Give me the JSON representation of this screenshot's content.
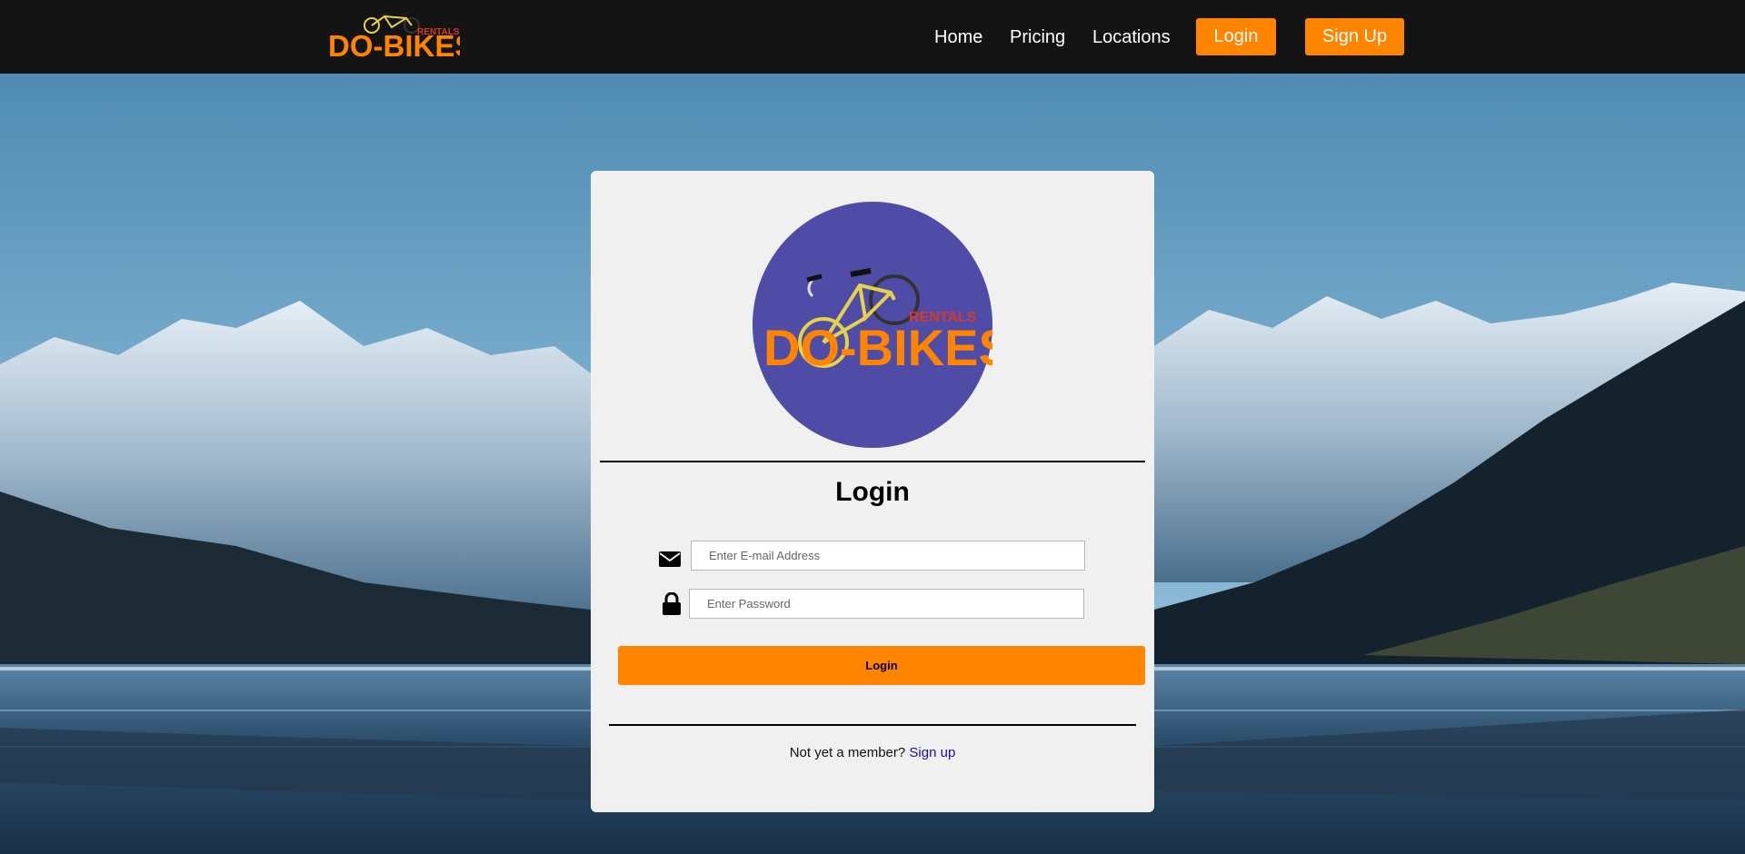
{
  "nav": {
    "logo_text": "DO-BIKES",
    "logo_subtext": "RENTALS",
    "links": [
      {
        "label": "Home"
      },
      {
        "label": "Pricing"
      },
      {
        "label": "Locations"
      }
    ],
    "login_label": "Login",
    "signup_label": "Sign Up"
  },
  "card": {
    "logo_text": "DO-BIKES",
    "logo_subtext": "RENTALS",
    "title": "Login",
    "email": {
      "placeholder": "Enter E-mail Address",
      "value": ""
    },
    "password": {
      "placeholder": "Enter Password",
      "value": ""
    },
    "submit_label": "Login",
    "member_prompt": "Not yet a member?",
    "signup_link": "Sign up"
  },
  "colors": {
    "accent": "#ff8500",
    "navbar": "#141414",
    "card_bg": "#f0f0f0",
    "logo_circle": "#4f4ca8",
    "link": "#1a0dab"
  },
  "icons": [
    "envelope-icon",
    "lock-icon",
    "bicycle-icon"
  ]
}
